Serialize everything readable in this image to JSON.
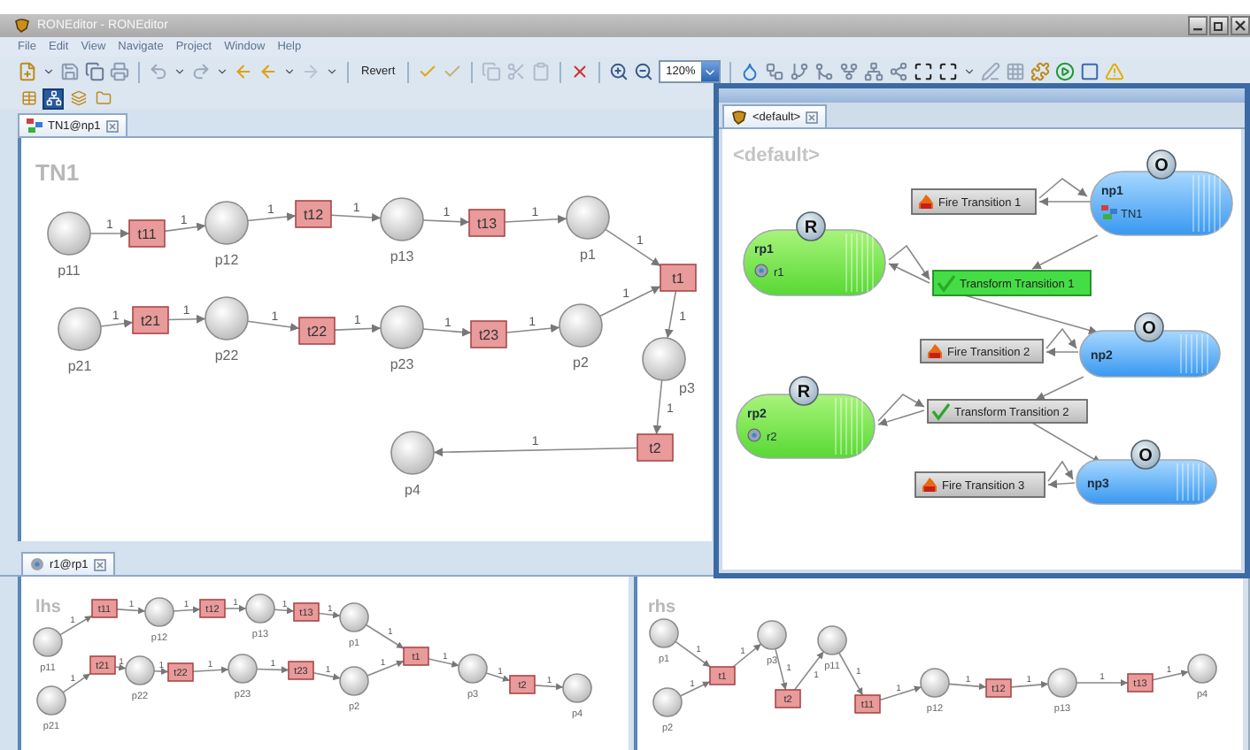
{
  "window": {
    "title": "RONEditor - RONEditor"
  },
  "menu": [
    "File",
    "Edit",
    "View",
    "Navigate",
    "Project",
    "Window",
    "Help"
  ],
  "toolbar": {
    "revert": "Revert",
    "zoom": "120%"
  },
  "view_toggles": [
    {
      "selected": false
    },
    {
      "selected": true
    },
    {
      "selected": false
    },
    {
      "selected": false
    }
  ],
  "editor_tab": {
    "label": "TN1@np1"
  },
  "net": {
    "title": "TN1",
    "nodes": [
      {
        "kind": "place",
        "label": "p11"
      },
      {
        "kind": "transition",
        "label": "t11"
      },
      {
        "kind": "place",
        "label": "p12"
      },
      {
        "kind": "transition",
        "label": "t12"
      },
      {
        "kind": "place",
        "label": "p13"
      },
      {
        "kind": "transition",
        "label": "t13"
      },
      {
        "kind": "place",
        "label": "p1"
      },
      {
        "kind": "transition",
        "label": "t1"
      },
      {
        "kind": "place",
        "label": "p21"
      },
      {
        "kind": "transition",
        "label": "t21"
      },
      {
        "kind": "place",
        "label": "p22"
      },
      {
        "kind": "transition",
        "label": "t22"
      },
      {
        "kind": "place",
        "label": "p23"
      },
      {
        "kind": "transition",
        "label": "t23"
      },
      {
        "kind": "place",
        "label": "p2"
      },
      {
        "kind": "place",
        "label": "p3"
      },
      {
        "kind": "transition",
        "label": "t2"
      },
      {
        "kind": "place",
        "label": "p4"
      }
    ],
    "arcs": [
      "1",
      "1",
      "1",
      "1",
      "1",
      "1",
      "1",
      "1",
      "1",
      "1",
      "1",
      "1",
      "1",
      "1",
      "1",
      "1",
      "1"
    ]
  },
  "floating_window": {
    "tab": "<default>",
    "title": "<default>",
    "nodes": [
      {
        "kind": "fire",
        "label": "Fire Transition 1"
      },
      {
        "kind": "object",
        "badge": "O",
        "name": "np1",
        "token": "TN1"
      },
      {
        "kind": "rule",
        "badge": "R",
        "name": "rp1",
        "token": "r1"
      },
      {
        "kind": "transform",
        "label": "Transform Transition 1",
        "enabled": true
      },
      {
        "kind": "fire",
        "label": "Fire Transition 2"
      },
      {
        "kind": "object",
        "badge": "O",
        "name": "np2"
      },
      {
        "kind": "rule",
        "badge": "R",
        "name": "rp2",
        "token": "r2"
      },
      {
        "kind": "transform",
        "label": "Transform Transition 2",
        "enabled": false
      },
      {
        "kind": "fire",
        "label": "Fire Transition 3"
      },
      {
        "kind": "object",
        "badge": "O",
        "name": "np3"
      }
    ]
  },
  "rule_tab": {
    "label": "r1@rp1"
  },
  "lhs": {
    "title": "lhs",
    "nodes": [
      {
        "kind": "place",
        "label": "p11"
      },
      {
        "kind": "transition",
        "label": "t11"
      },
      {
        "kind": "place",
        "label": "p12"
      },
      {
        "kind": "transition",
        "label": "t12"
      },
      {
        "kind": "place",
        "label": "p13"
      },
      {
        "kind": "transition",
        "label": "t13"
      },
      {
        "kind": "place",
        "label": "p1"
      },
      {
        "kind": "transition",
        "label": "t1"
      },
      {
        "kind": "place",
        "label": "p21"
      },
      {
        "kind": "transition",
        "label": "t21"
      },
      {
        "kind": "place",
        "label": "p22"
      },
      {
        "kind": "transition",
        "label": "t22"
      },
      {
        "kind": "place",
        "label": "p23"
      },
      {
        "kind": "transition",
        "label": "t23"
      },
      {
        "kind": "place",
        "label": "p2"
      },
      {
        "kind": "place",
        "label": "p3"
      },
      {
        "kind": "transition",
        "label": "t2"
      },
      {
        "kind": "place",
        "label": "p4"
      }
    ],
    "arcs": [
      "1",
      "1",
      "1",
      "1",
      "1",
      "1",
      "1",
      "1",
      "1",
      "1",
      "1",
      "1",
      "1",
      "1",
      "1",
      "1",
      "1"
    ]
  },
  "rhs": {
    "title": "rhs",
    "nodes": [
      {
        "kind": "place",
        "label": "p1"
      },
      {
        "kind": "place",
        "label": "p2"
      },
      {
        "kind": "transition",
        "label": "t1"
      },
      {
        "kind": "place",
        "label": "p3"
      },
      {
        "kind": "transition",
        "label": "t2"
      },
      {
        "kind": "place",
        "label": "p11"
      },
      {
        "kind": "transition",
        "label": "t11"
      },
      {
        "kind": "place",
        "label": "p12"
      },
      {
        "kind": "transition",
        "label": "t12"
      },
      {
        "kind": "place",
        "label": "p13"
      },
      {
        "kind": "transition",
        "label": "t13"
      },
      {
        "kind": "place",
        "label": "p4"
      }
    ],
    "arcs": [
      "1",
      "1",
      "1",
      "1",
      "1",
      "1",
      "1",
      "1",
      "1",
      "1",
      "1"
    ]
  }
}
